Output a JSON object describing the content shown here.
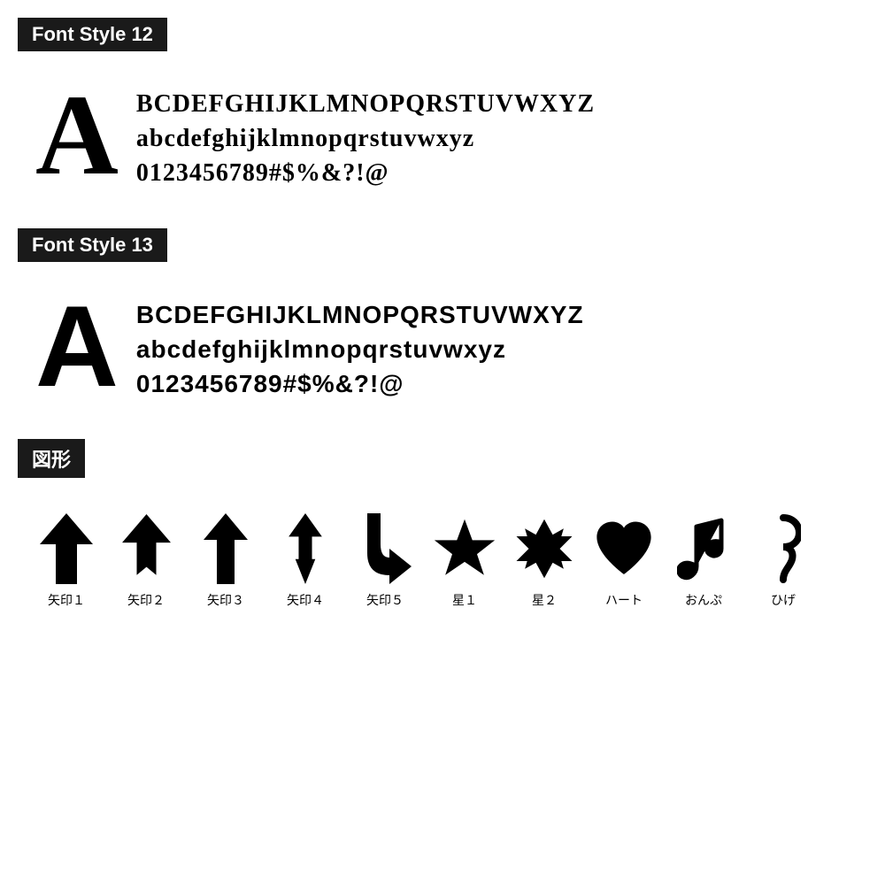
{
  "sections": [
    {
      "id": "font-style-12",
      "label": "Font Style 12",
      "bigLetter": "A",
      "lines": [
        "BCDEFGHIJKLMNOPQRSTUVWXYZ",
        "abcdefghijklmnopqrstuvwxyz",
        "0123456789#$%&?!@"
      ],
      "fontClass": "font-style-12"
    },
    {
      "id": "font-style-13",
      "label": "Font Style 13",
      "bigLetter": "A",
      "lines": [
        "BCDEFGHIJKLMNOPQRSTUVWXYZ",
        "abcdefghijklmnopqrstuvwxyz",
        "0123456789#$%&?!@"
      ],
      "fontClass": "font-style-13"
    }
  ],
  "shapesSection": {
    "label": "図形",
    "shapes": [
      {
        "id": "yazirushi1",
        "label": "矢印１"
      },
      {
        "id": "yazirushi2",
        "label": "矢印２"
      },
      {
        "id": "yazirushi3",
        "label": "矢印３"
      },
      {
        "id": "yazirushi4",
        "label": "矢印４"
      },
      {
        "id": "yazirushi5",
        "label": "矢印５"
      },
      {
        "id": "hoshi1",
        "label": "星１"
      },
      {
        "id": "hoshi2",
        "label": "星２"
      },
      {
        "id": "heart",
        "label": "ハート"
      },
      {
        "id": "onpu",
        "label": "おんぷ"
      },
      {
        "id": "hige",
        "label": "ひげ"
      }
    ]
  }
}
